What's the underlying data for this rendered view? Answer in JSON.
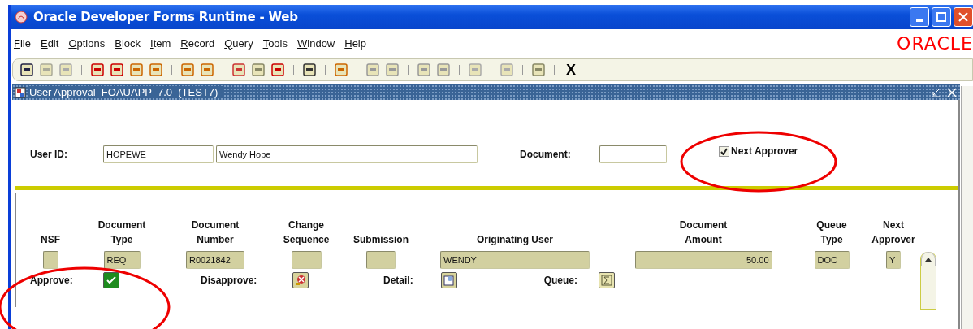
{
  "window": {
    "title": "Oracle Developer Forms Runtime - Web"
  },
  "menu": [
    {
      "label": "File"
    },
    {
      "label": "Edit"
    },
    {
      "label": "Options"
    },
    {
      "label": "Block"
    },
    {
      "label": "Item"
    },
    {
      "label": "Record"
    },
    {
      "label": "Query"
    },
    {
      "label": "Tools"
    },
    {
      "label": "Window"
    },
    {
      "label": "Help"
    }
  ],
  "logo": "ORACLE",
  "toolbar": {
    "exit_label": "X"
  },
  "form": {
    "title": "User Approval  FOAUAPP  7.0  (TEST7)",
    "user_id_label": "User ID:",
    "user_id": "HOPEWE",
    "user_name": "Wendy Hope",
    "document_label": "Document:",
    "next_approver": {
      "label": "Next Approver",
      "checked": true
    }
  },
  "columns": [
    {
      "label": "NSF",
      "kind": "text"
    },
    {
      "label": "Document\nType",
      "kind": "text",
      "value": "REQ"
    },
    {
      "label": "Document\nNumber",
      "kind": "text",
      "value": "R0021842"
    },
    {
      "label": "Change\nSequence",
      "kind": "text"
    },
    {
      "label": "Submission",
      "kind": "text"
    },
    {
      "label": "Originating User",
      "kind": "text",
      "value": "WENDY"
    },
    {
      "label": "Document\nAmount",
      "kind": "amount",
      "value": "50.00"
    },
    {
      "label": "Queue\nType",
      "kind": "text",
      "value": "DOC"
    },
    {
      "label": "Next\nApprover",
      "kind": "text",
      "value": "Y"
    }
  ],
  "actions": [
    {
      "label": "Approve:",
      "kind": "approve"
    },
    {
      "label": "Disapprove:",
      "kind": "disapprove"
    },
    {
      "label": "Detail:",
      "kind": "detail"
    },
    {
      "label": "Queue:",
      "kind": "queue"
    }
  ]
}
